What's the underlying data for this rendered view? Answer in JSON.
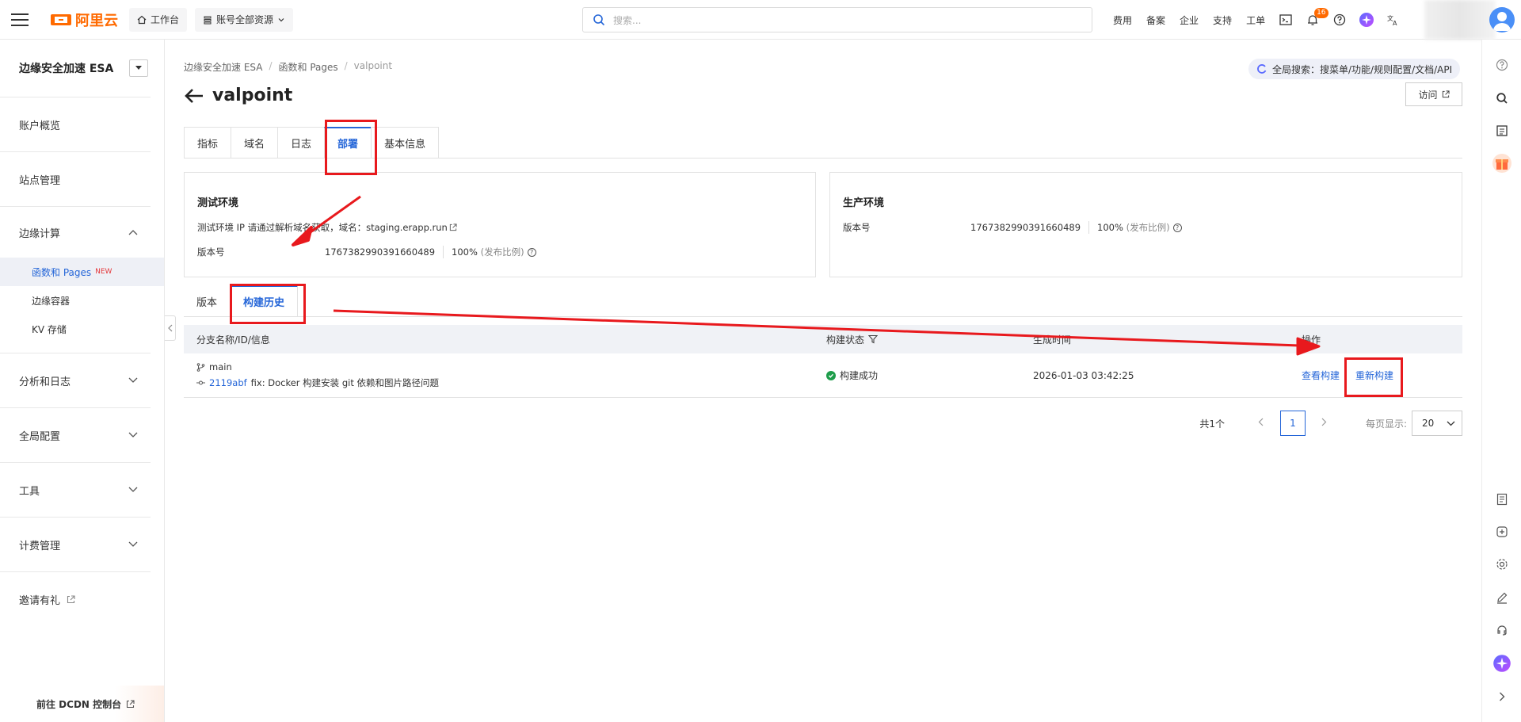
{
  "topbar": {
    "logo_text": "阿里云",
    "workbench": "工作台",
    "account_scope": "账号全部资源",
    "search_placeholder": "搜索...",
    "links": [
      "费用",
      "备案",
      "企业",
      "支持",
      "工单"
    ],
    "notification_count": "16"
  },
  "sidebar": {
    "product_title": "边缘安全加速 ESA",
    "items": [
      {
        "label": "账户概览"
      },
      {
        "label": "站点管理"
      }
    ],
    "edge_compute": {
      "label": "边缘计算",
      "children": [
        {
          "label": "函数和 Pages",
          "tag": "NEW"
        },
        {
          "label": "边缘容器"
        },
        {
          "label": "KV 存储"
        }
      ]
    },
    "collapsed_groups": [
      {
        "label": "分析和日志"
      },
      {
        "label": "全局配置"
      },
      {
        "label": "工具"
      },
      {
        "label": "计费管理"
      }
    ],
    "invite": "邀请有礼",
    "footer": "前往 DCDN 控制台"
  },
  "breadcrumb": [
    "边缘安全加速 ESA",
    "函数和 Pages",
    "valpoint"
  ],
  "page": {
    "title": "valpoint",
    "global_search": "全局搜索：搜菜单/功能/规则配置/文档/API",
    "visit_button": "访问"
  },
  "tabs": [
    "指标",
    "域名",
    "日志",
    "部署",
    "基本信息"
  ],
  "active_tab": "部署",
  "staging": {
    "title": "测试环境",
    "notice": "测试环境 IP 请通过解析域名获取，域名：staging.erapp.run",
    "version_label": "版本号",
    "version": "1767382990391660489",
    "percent": "100%",
    "percent_note": "(发布比例)"
  },
  "production": {
    "title": "生产环境",
    "version_label": "版本号",
    "version": "1767382990391660489",
    "percent": "100%",
    "percent_note": "(发布比例)"
  },
  "subtabs": [
    "版本",
    "构建历史"
  ],
  "active_subtab": "构建历史",
  "table": {
    "headers": [
      "分支名称/ID/信息",
      "构建状态",
      "生成时间",
      "操作"
    ],
    "rows": [
      {
        "branch": "main",
        "commit_id": "2119abf",
        "message": "fix: Docker 构建安装 git 依赖和图片路径问题",
        "status": "构建成功",
        "time": "2026-01-03 03:42:25",
        "actions": [
          "查看构建",
          "重新构建"
        ]
      }
    ]
  },
  "pager": {
    "total": "共1个",
    "current_page": "1",
    "per_page_label": "每页显示:",
    "per_page": "20"
  },
  "colors": {
    "brand": "#ff6a00",
    "primary": "#2566d8",
    "success": "#1e9d4b",
    "annotation": "#e8191d"
  }
}
